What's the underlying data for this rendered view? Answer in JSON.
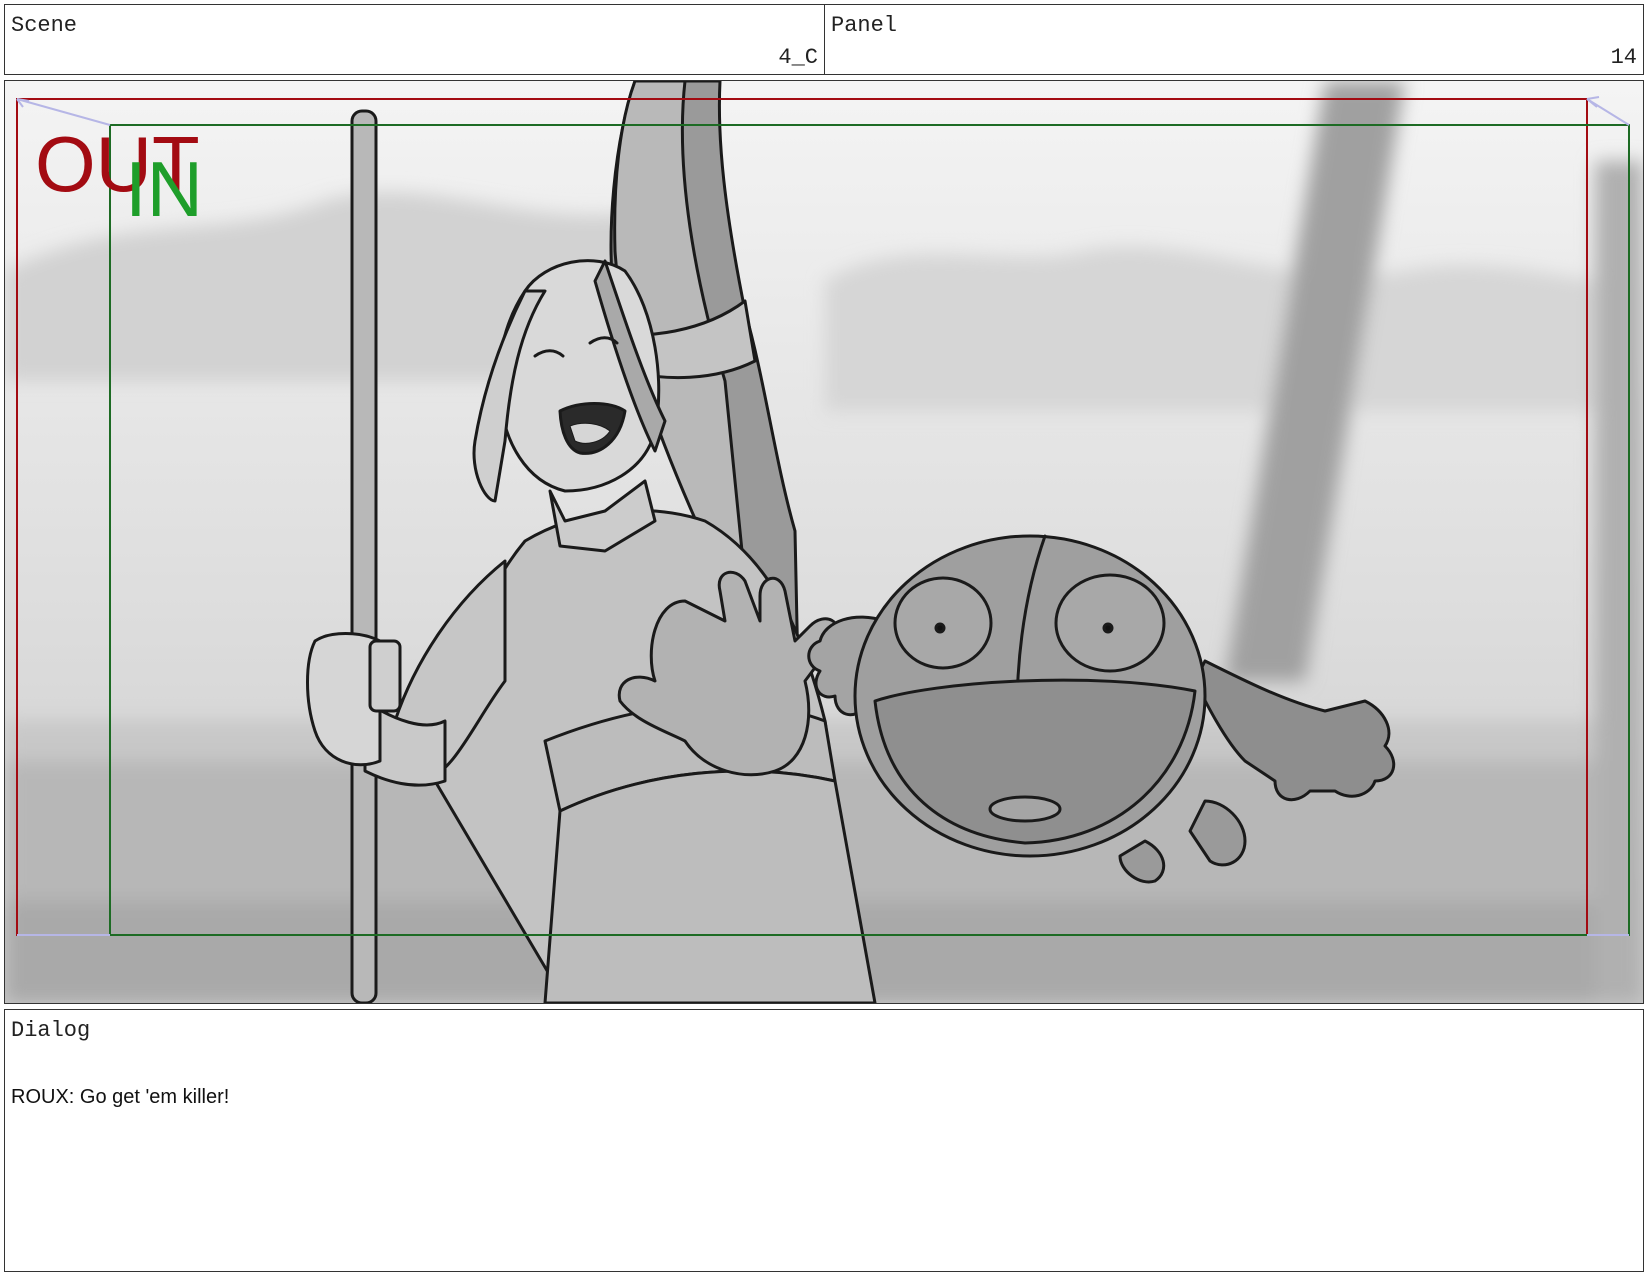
{
  "header": {
    "scene_label": "Scene",
    "scene_value": "4_C",
    "panel_label": "Panel",
    "panel_value": "14"
  },
  "frame": {
    "out_label": "OUT",
    "in_label": "IN",
    "out_color": "#a30b12",
    "in_color": "#1e9e2a"
  },
  "dialog": {
    "label": "Dialog",
    "text": "ROUX: Go get 'em killer!"
  }
}
